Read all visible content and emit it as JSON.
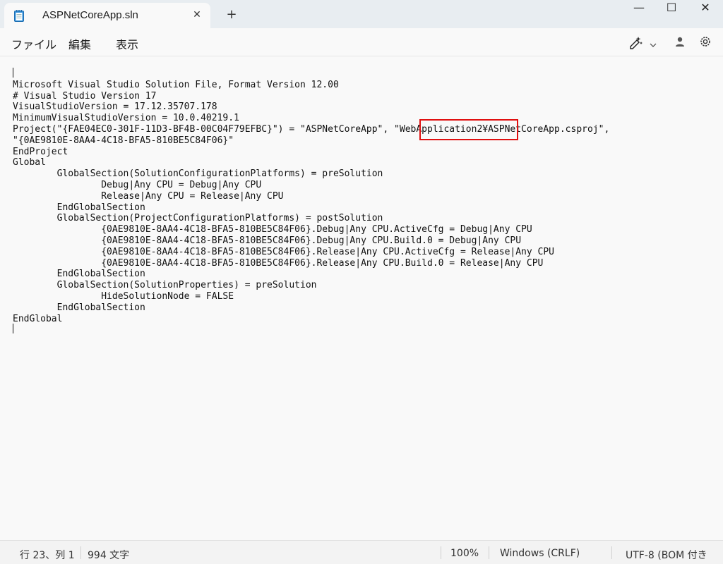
{
  "window": {
    "tab_title": "ASPNetCoreApp.sln",
    "close_tab_glyph": "✕",
    "new_tab_glyph": "+",
    "minimize_glyph": "—",
    "maximize_glyph": "☐",
    "close_glyph": "✕"
  },
  "menu": {
    "file": "ファイル",
    "edit": "編集",
    "view": "表示"
  },
  "toolbar": {
    "icons": [
      "copilot-icon",
      "chevron-down-icon",
      "account-icon",
      "settings-icon"
    ]
  },
  "document": {
    "lines": [
      "",
      "Microsoft Visual Studio Solution File, Format Version 12.00",
      "# Visual Studio Version 17",
      "VisualStudioVersion = 17.12.35707.178",
      "MinimumVisualStudioVersion = 10.0.40219.1",
      "Project(\"{FAE04EC0-301F-11D3-BF4B-00C04F79EFBC}\") = \"ASPNetCoreApp\", \"WebApplication2¥ASPNetCoreApp.csproj\",",
      "\"{0AE9810E-8AA4-4C18-BFA5-810BE5C84F06}\"",
      "EndProject",
      "Global",
      "        GlobalSection(SolutionConfigurationPlatforms) = preSolution",
      "                Debug|Any CPU = Debug|Any CPU",
      "                Release|Any CPU = Release|Any CPU",
      "        EndGlobalSection",
      "        GlobalSection(ProjectConfigurationPlatforms) = postSolution",
      "                {0AE9810E-8AA4-4C18-BFA5-810BE5C84F06}.Debug|Any CPU.ActiveCfg = Debug|Any CPU",
      "                {0AE9810E-8AA4-4C18-BFA5-810BE5C84F06}.Debug|Any CPU.Build.0 = Debug|Any CPU",
      "                {0AE9810E-8AA4-4C18-BFA5-810BE5C84F06}.Release|Any CPU.ActiveCfg = Release|Any CPU",
      "                {0AE9810E-8AA4-4C18-BFA5-810BE5C84F06}.Release|Any CPU.Build.0 = Release|Any CPU",
      "        EndGlobalSection",
      "        GlobalSection(SolutionProperties) = preSolution",
      "                HideSolutionNode = FALSE",
      "        EndGlobalSection",
      "EndGlobal",
      ""
    ],
    "highlight_color": "#e01010"
  },
  "status": {
    "position": "行 23、列 1",
    "chars": "994 文字",
    "zoom": "100%",
    "line_ending": "Windows (CRLF)",
    "encoding": "UTF-8 (BOM 付き"
  }
}
